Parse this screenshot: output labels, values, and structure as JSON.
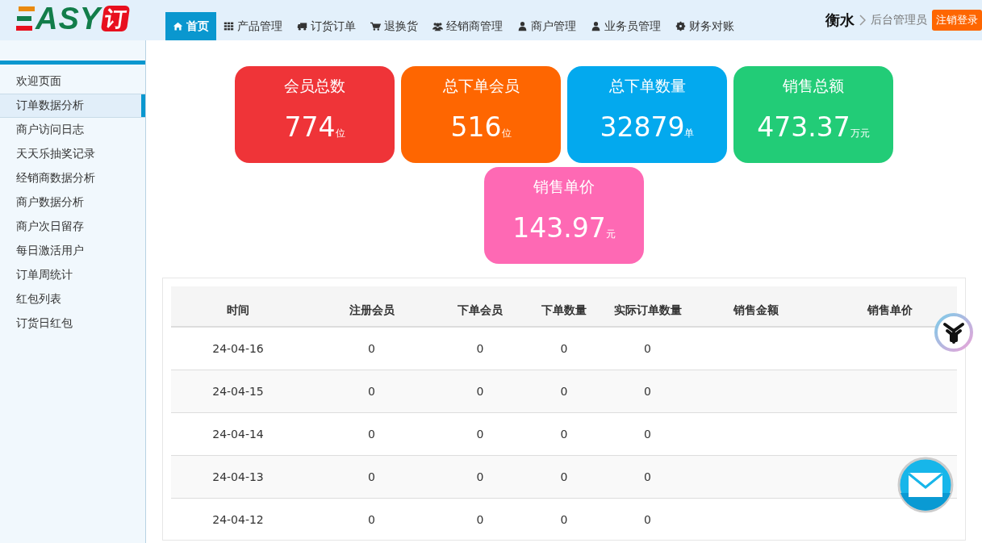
{
  "logo": {
    "text": "ASY",
    "badge": "订"
  },
  "nav": [
    {
      "label": "首页",
      "selected": true
    },
    {
      "label": "产品管理",
      "selected": false
    },
    {
      "label": "订货订单",
      "selected": false
    },
    {
      "label": "退换货",
      "selected": false
    },
    {
      "label": "经销商管理",
      "selected": false
    },
    {
      "label": "商户管理",
      "selected": false
    },
    {
      "label": "业务员管理",
      "selected": false
    },
    {
      "label": "财务对账",
      "selected": false
    }
  ],
  "user": {
    "city": "衡水",
    "role": "后台管理员",
    "logout": "注销登录"
  },
  "sidebar": {
    "items": [
      {
        "label": "欢迎页面",
        "selected": false
      },
      {
        "label": "订单数据分析",
        "selected": true
      },
      {
        "label": "商户访问日志",
        "selected": false
      },
      {
        "label": "天天乐抽奖记录",
        "selected": false
      },
      {
        "label": "经销商数据分析",
        "selected": false
      },
      {
        "label": "商户数据分析",
        "selected": false
      },
      {
        "label": "商户次日留存",
        "selected": false
      },
      {
        "label": "每日激活用户",
        "selected": false
      },
      {
        "label": "订单周统计",
        "selected": false
      },
      {
        "label": "红包列表",
        "selected": false
      },
      {
        "label": "订货日红包",
        "selected": false
      }
    ]
  },
  "stats": [
    {
      "title": "会员总数",
      "value": "774",
      "unit": "位",
      "color": "#ef3438"
    },
    {
      "title": "总下单会员",
      "value": "516",
      "unit": "位",
      "color": "#fe6601"
    },
    {
      "title": "总下单数量",
      "value": "32879",
      "unit": "单",
      "color": "#03a9ee"
    },
    {
      "title": "销售总额",
      "value": "473.37",
      "unit": "万元",
      "color": "#22cc77"
    },
    {
      "title": "销售单价",
      "value": "143.97",
      "unit": "元",
      "color": "#fe69b4"
    }
  ],
  "table": {
    "columns": [
      "时间",
      "注册会员",
      "下单会员",
      "下单数量",
      "实际订单数量",
      "销售金额",
      "销售单价"
    ],
    "rows": [
      [
        "24-04-16",
        "0",
        "0",
        "0",
        "0"
      ],
      [
        "24-04-15",
        "0",
        "0",
        "0",
        "0"
      ],
      [
        "24-04-14",
        "0",
        "0",
        "0",
        "0"
      ],
      [
        "24-04-13",
        "0",
        "0",
        "0",
        "0"
      ],
      [
        "24-04-12",
        "0",
        "0",
        "0",
        "0"
      ]
    ]
  }
}
